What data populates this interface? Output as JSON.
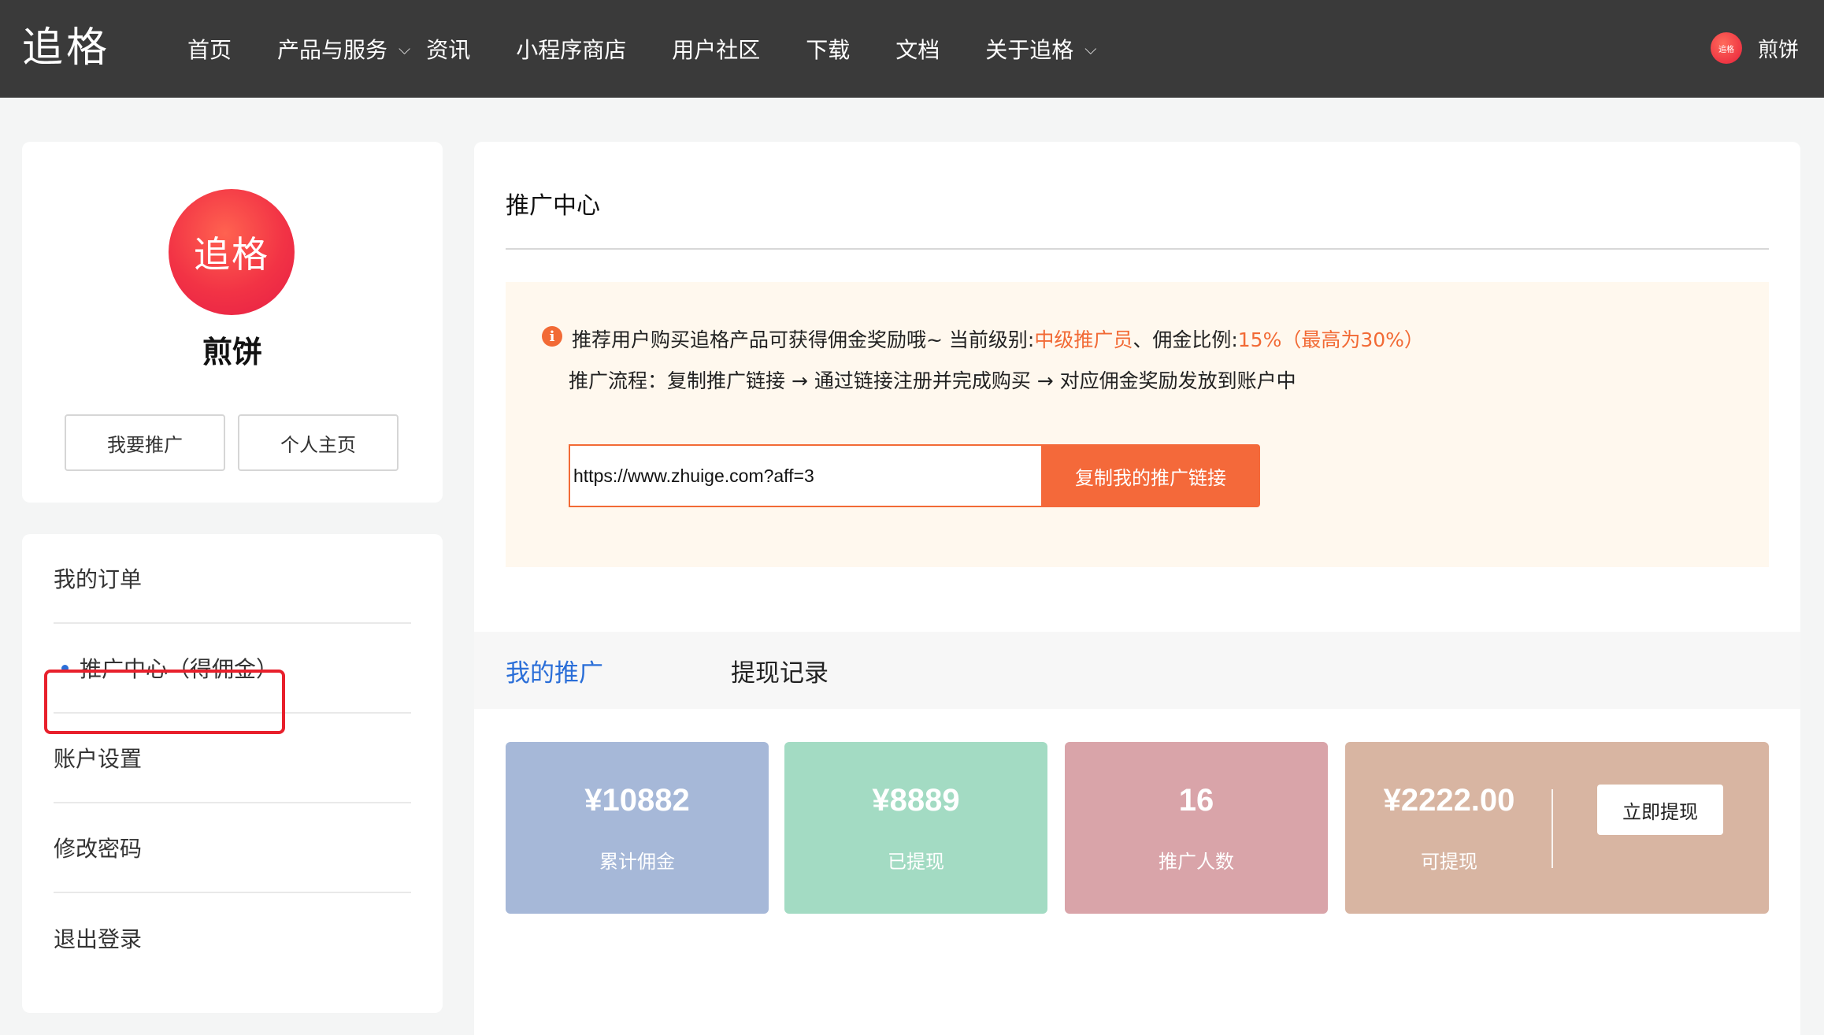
{
  "header": {
    "logo": "追格",
    "nav": [
      {
        "label": "首页",
        "has_dropdown": false
      },
      {
        "label": "产品与服务",
        "has_dropdown": true
      },
      {
        "label": "资讯",
        "has_dropdown": false
      },
      {
        "label": "小程序商店",
        "has_dropdown": false
      },
      {
        "label": "用户社区",
        "has_dropdown": false
      },
      {
        "label": "下载",
        "has_dropdown": false
      },
      {
        "label": "文档",
        "has_dropdown": false
      },
      {
        "label": "关于追格",
        "has_dropdown": true
      }
    ],
    "avatar_text": "追格",
    "user_name": "煎饼"
  },
  "profile": {
    "avatar_text": "追格",
    "name": "煎饼",
    "promote_button": "我要推广",
    "home_button": "个人主页"
  },
  "menu": {
    "items": [
      {
        "label": "我的订单",
        "active": false
      },
      {
        "label": "推广中心（得佣金）",
        "active": true
      },
      {
        "label": "账户设置",
        "active": false
      },
      {
        "label": "修改密码",
        "active": false
      },
      {
        "label": "退出登录",
        "active": false
      }
    ]
  },
  "main": {
    "title": "推广中心",
    "notice": {
      "text1": "推荐用户购买追格产品可获得佣金奖励哦~ 当前级别:",
      "level": "中级推广员",
      "text2": "、佣金比例:",
      "ratio": "15%（最高为30%）",
      "process": "推广流程：复制推广链接 → 通过链接注册并完成购买 → 对应佣金奖励发放到账户中"
    },
    "link_value": "https://www.zhuige.com?aff=3",
    "copy_button": "复制我的推广链接",
    "tabs": [
      {
        "label": "我的推广",
        "active": true
      },
      {
        "label": "提现记录",
        "active": false
      }
    ],
    "stats": [
      {
        "value": "¥10882",
        "label": "累计佣金"
      },
      {
        "value": "¥8889",
        "label": "已提现"
      },
      {
        "value": "16",
        "label": "推广人数"
      },
      {
        "value": "¥2222.00",
        "label": "可提现"
      }
    ],
    "withdraw_button": "立即提现"
  },
  "colors": {
    "topbar": "#3a3a3a",
    "accent_orange": "#f26a35",
    "active_blue": "#2a6ed8",
    "highlight_red": "#e8202c"
  }
}
